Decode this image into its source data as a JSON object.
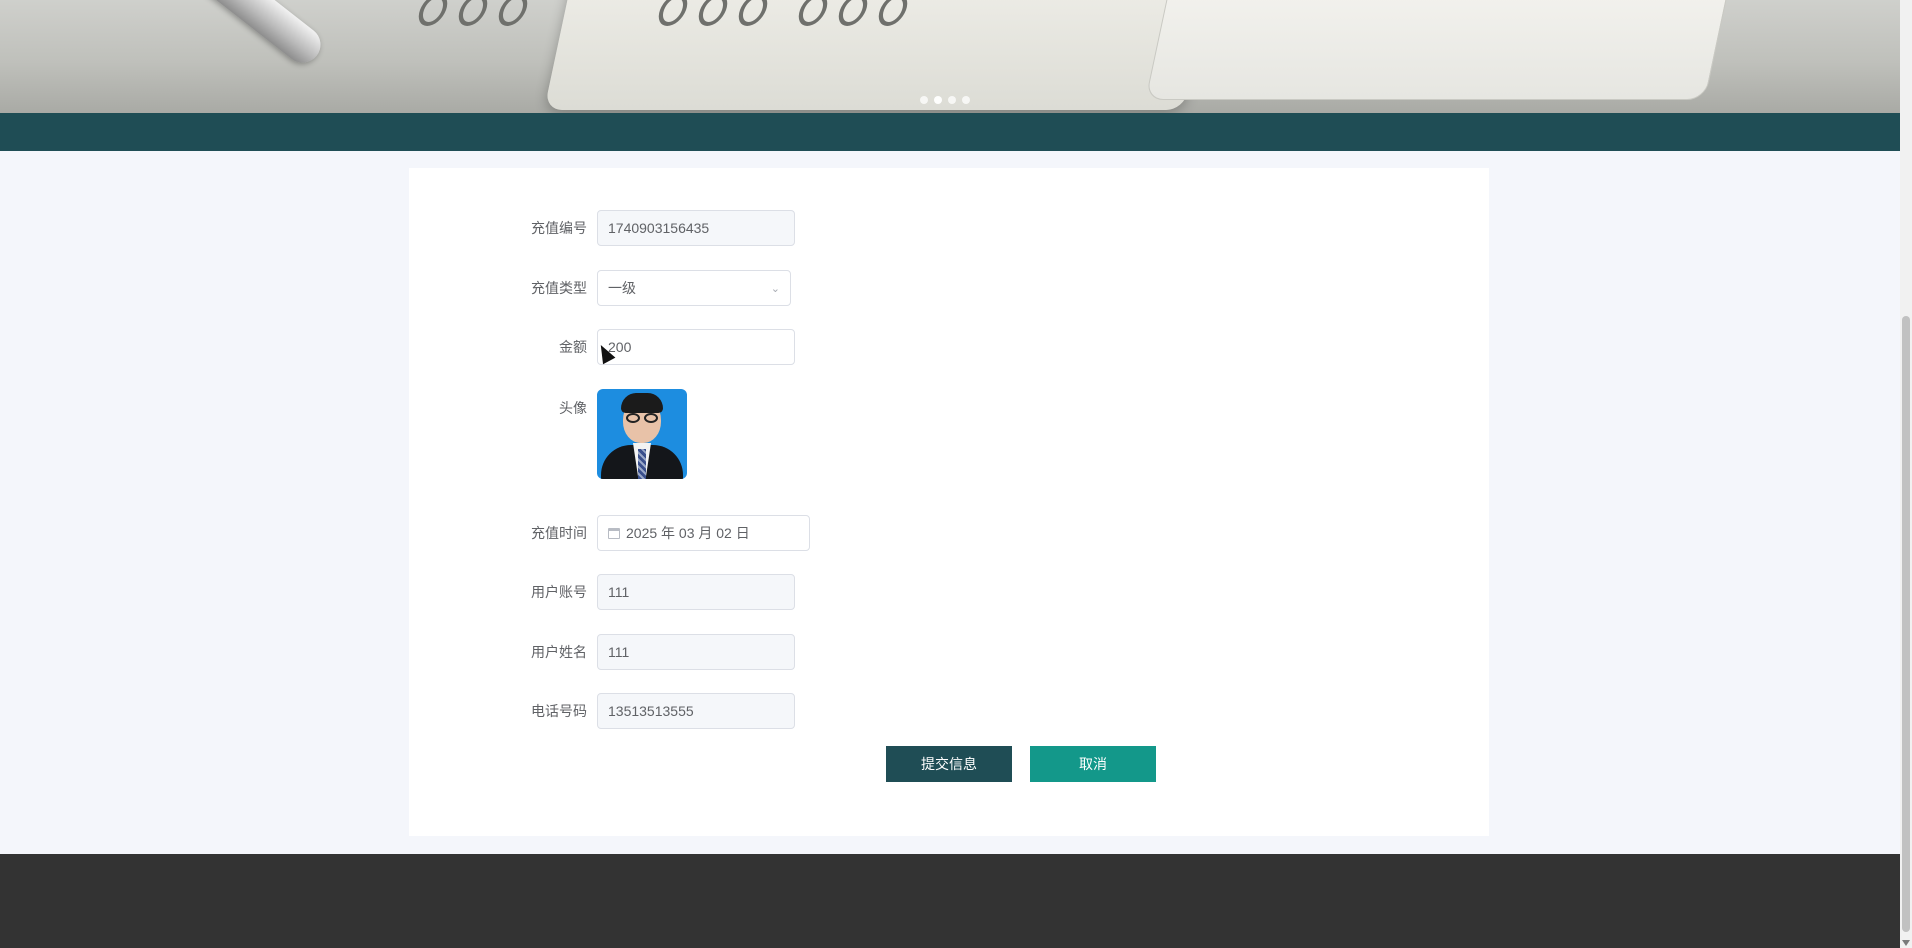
{
  "banner": {
    "carousel_dots": 4,
    "active_dot": 2
  },
  "form": {
    "fields": {
      "recharge_no": {
        "label": "充值编号",
        "value": "1740903156435"
      },
      "recharge_type": {
        "label": "充值类型",
        "value": "一级"
      },
      "amount": {
        "label": "金额",
        "value": "200"
      },
      "avatar": {
        "label": "头像"
      },
      "recharge_time": {
        "label": "充值时间",
        "value": "2025 年 03 月 02 日"
      },
      "user_account": {
        "label": "用户账号",
        "value": "111"
      },
      "user_name": {
        "label": "用户姓名",
        "value": "111"
      },
      "phone": {
        "label": "电话号码",
        "value": "13513513555"
      }
    },
    "buttons": {
      "submit": "提交信息",
      "cancel": "取消"
    }
  },
  "icons": {
    "select_arrow": "chevron-down-icon",
    "date": "calendar-icon"
  },
  "colors": {
    "nav": "#1f4d55",
    "submit": "#1f4d55",
    "cancel": "#13988a",
    "footer": "#333333"
  }
}
